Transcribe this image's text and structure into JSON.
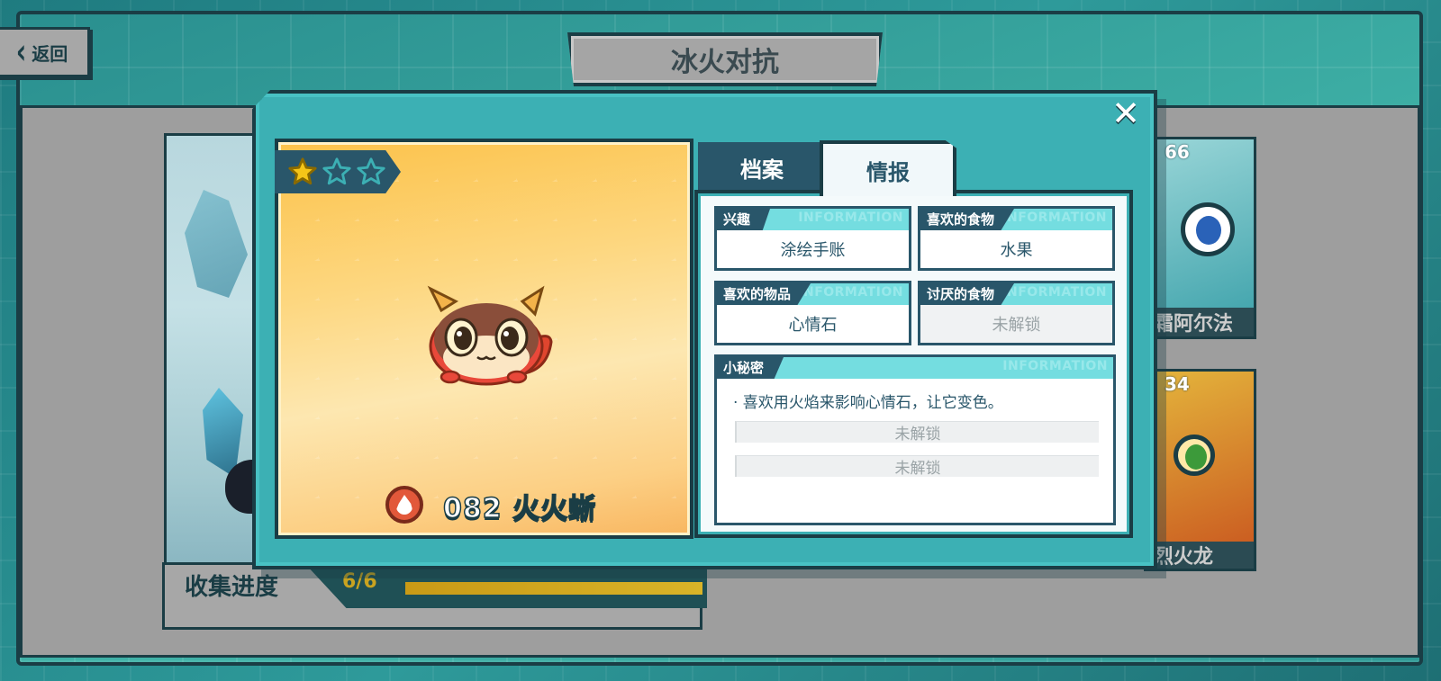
{
  "header": {
    "back_label": "返回",
    "title": "冰火对抗"
  },
  "collection": {
    "label": "收集进度",
    "count": "6/6",
    "progress": 1.0
  },
  "side_cards": [
    {
      "number": "66",
      "name": "霜阿尔法"
    },
    {
      "number": "34",
      "name": "烈火龙"
    }
  ],
  "modal": {
    "close_icon": "close-icon",
    "rarity_stars": {
      "filled": 1,
      "total": 3
    },
    "monster": {
      "element": "fire",
      "number_name": "082 火火蜥"
    },
    "tabs": [
      {
        "label": "档案",
        "active": false
      },
      {
        "label": "情报",
        "active": true
      }
    ],
    "info": {
      "watermark": "INFORMATION",
      "hobby": {
        "label": "兴趣",
        "value": "涂绘手账"
      },
      "favorite_food": {
        "label": "喜欢的食物",
        "value": "水果"
      },
      "favorite_item": {
        "label": "喜欢的物品",
        "value": "心情石"
      },
      "disliked_food": {
        "label": "讨厌的食物",
        "value": "未解锁"
      },
      "secret": {
        "label": "小秘密",
        "lines": [
          "· 喜欢用火焰来影响心情石，让它变色。"
        ],
        "locked": [
          "未解锁",
          "未解锁"
        ]
      }
    }
  },
  "colors": {
    "frame_dark": "#1a3d45",
    "modal_teal": "#3cb0b4",
    "header_cyan": "#74dde0",
    "tag_navy": "#29566a",
    "star_gold": "#f5c518",
    "progress_gold": "#d9b428"
  }
}
